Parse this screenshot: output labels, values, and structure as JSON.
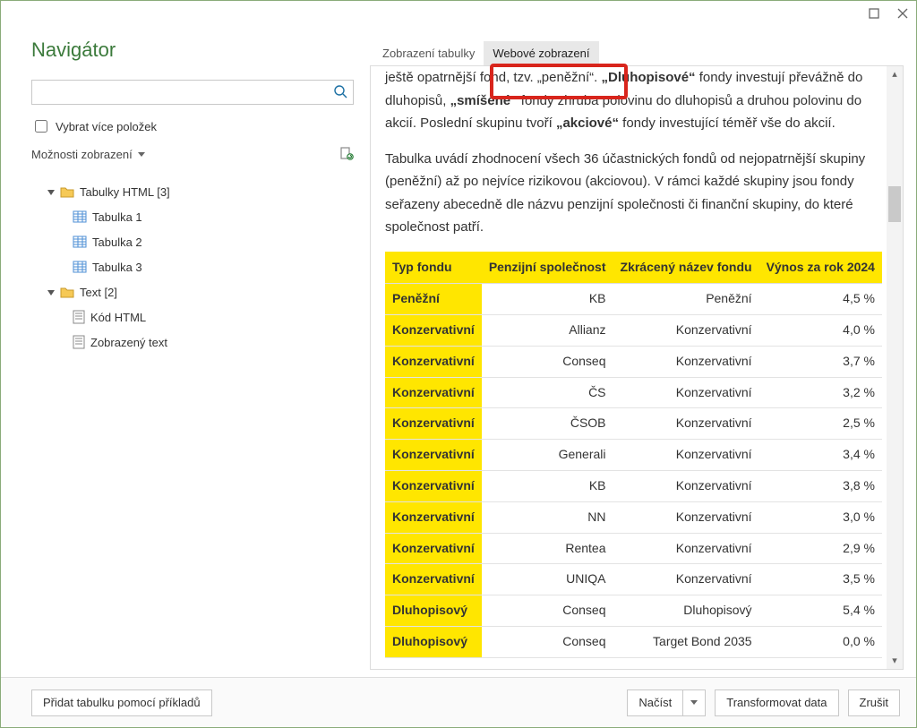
{
  "window": {
    "title": "Navigátor"
  },
  "left": {
    "search_placeholder": "",
    "select_multiple_label": "Vybrat více položek",
    "display_options_label": "Možnosti zobrazení",
    "tree": {
      "group_html_tables": "Tabulky HTML [3]",
      "table1": "Tabulka 1",
      "table2": "Tabulka 2",
      "table3": "Tabulka 3",
      "group_text": "Text [2]",
      "html_code": "Kód HTML",
      "displayed_text": "Zobrazený text"
    }
  },
  "tabs": {
    "table_view": "Zobrazení tabulky",
    "web_view": "Webové zobrazení"
  },
  "article": {
    "para1_pre": "ještě opatrnější fond, tzv. „peněžní“. ",
    "para1_bold1": "„Dluhopisové“",
    "para1_mid1": " fondy investují převážně do dluhopisů, ",
    "para1_bold2": "„smíšené“",
    "para1_mid2": " fondy zhruba polovinu do dluhopisů a druhou polovinu do akcií. Poslední skupinu tvoří ",
    "para1_bold3": "„akciové“",
    "para1_post": " fondy investující téměř vše do akcií.",
    "para2": "Tabulka uvádí zhodnocení všech 36 účastnických fondů od nejopatrnější skupiny (peněžní) až po nejvíce rizikovou (akciovou). V rámci každé skupiny jsou fondy seřazeny abecedně dle názvu penzijní společnosti či finanční skupiny, do které společnost patří."
  },
  "chart_data": {
    "type": "table",
    "columns": [
      "Typ fondu",
      "Penzijní společnost",
      "Zkrácený název fondu",
      "Výnos za rok 2024"
    ],
    "rows": [
      [
        "Peněžní",
        "KB",
        "Peněžní",
        "4,5 %"
      ],
      [
        "Konzervativní",
        "Allianz",
        "Konzervativní",
        "4,0 %"
      ],
      [
        "Konzervativní",
        "Conseq",
        "Konzervativní",
        "3,7 %"
      ],
      [
        "Konzervativní",
        "ČS",
        "Konzervativní",
        "3,2 %"
      ],
      [
        "Konzervativní",
        "ČSOB",
        "Konzervativní",
        "2,5 %"
      ],
      [
        "Konzervativní",
        "Generali",
        "Konzervativní",
        "3,4 %"
      ],
      [
        "Konzervativní",
        "KB",
        "Konzervativní",
        "3,8 %"
      ],
      [
        "Konzervativní",
        "NN",
        "Konzervativní",
        "3,0 %"
      ],
      [
        "Konzervativní",
        "Rentea",
        "Konzervativní",
        "2,9 %"
      ],
      [
        "Konzervativní",
        "UNIQA",
        "Konzervativní",
        "3,5 %"
      ],
      [
        "Dluhopisový",
        "Conseq",
        "Dluhopisový",
        "5,4 %"
      ],
      [
        "Dluhopisový",
        "Conseq",
        "Target Bond 2035",
        "0,0 %"
      ]
    ]
  },
  "footer": {
    "add_table_examples": "Přidat tabulku pomocí příkladů",
    "load": "Načíst",
    "transform": "Transformovat data",
    "cancel": "Zrušit"
  }
}
